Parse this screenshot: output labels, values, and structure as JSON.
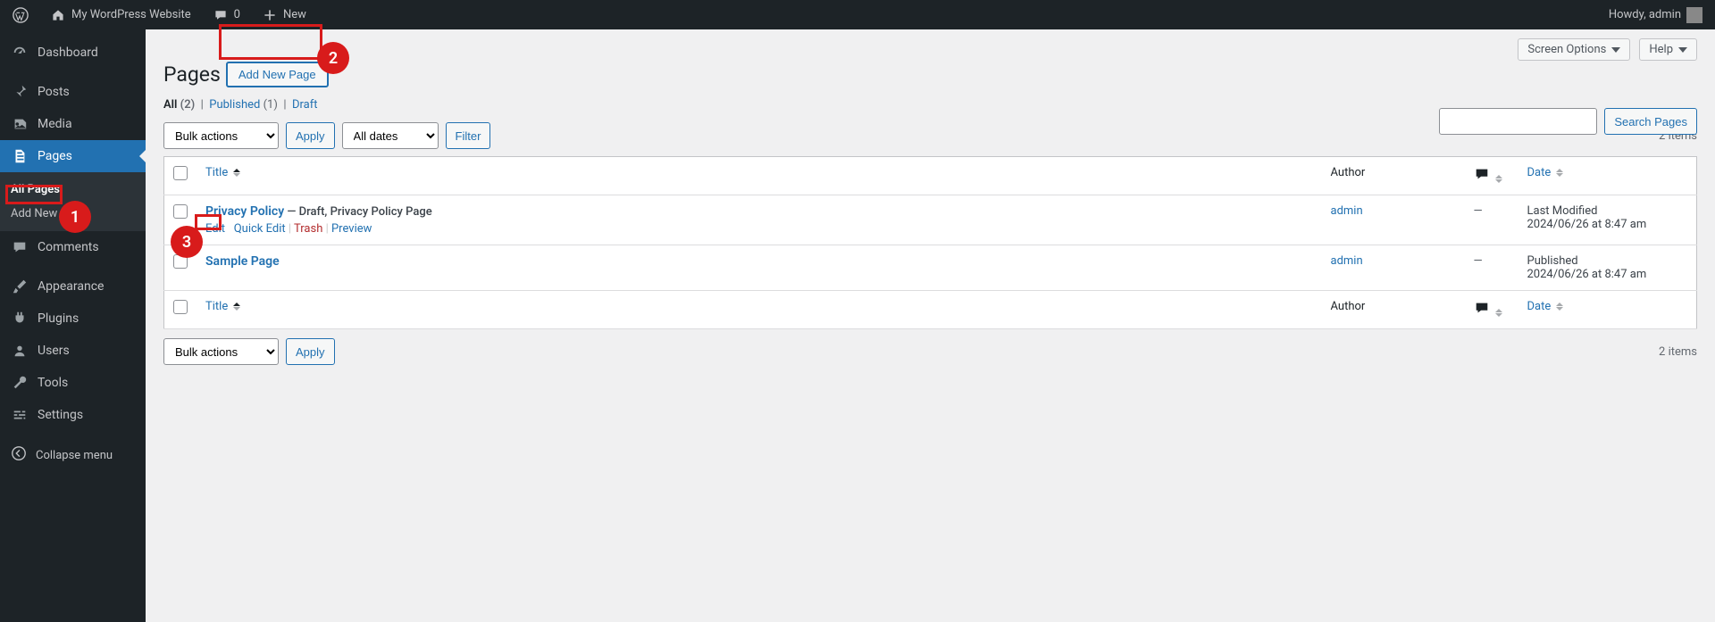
{
  "topbar": {
    "site_name": "My WordPress Website",
    "comments_count": "0",
    "new_label": "New",
    "howdy": "Howdy, admin"
  },
  "sidebar": {
    "dashboard": "Dashboard",
    "posts": "Posts",
    "media": "Media",
    "pages": "Pages",
    "pages_sub_all": "All Pages",
    "pages_sub_add": "Add New",
    "comments": "Comments",
    "appearance": "Appearance",
    "plugins": "Plugins",
    "users": "Users",
    "tools": "Tools",
    "settings": "Settings",
    "collapse": "Collapse menu"
  },
  "screen_options": "Screen Options",
  "help": "Help",
  "heading": "Pages",
  "add_new_page": "Add New Page",
  "filters": {
    "all_label": "All",
    "all_count": "(2)",
    "published_label": "Published",
    "published_count": "(1)",
    "draft_label": "Draft",
    "draft_count": ""
  },
  "bulk_actions": "Bulk actions",
  "apply": "Apply",
  "all_dates": "All dates",
  "filter": "Filter",
  "items_count": "2 items",
  "search_pages": "Search Pages",
  "columns": {
    "title": "Title",
    "author": "Author",
    "date": "Date"
  },
  "rows": [
    {
      "title": "Privacy Policy",
      "state": " — Draft, Privacy Policy Page",
      "author": "admin",
      "comments": "—",
      "date_status": "Last Modified",
      "date_value": "2024/06/26 at 8:47 am",
      "actions": {
        "edit": "Edit",
        "quick": "Quick Edit",
        "trash": "Trash",
        "preview": "Preview"
      }
    },
    {
      "title": "Sample Page",
      "state": "",
      "author": "admin",
      "comments": "—",
      "date_status": "Published",
      "date_value": "2024/06/26 at 8:47 am"
    }
  ],
  "annotations": {
    "n1": "1",
    "n2": "2",
    "n3": "3"
  }
}
